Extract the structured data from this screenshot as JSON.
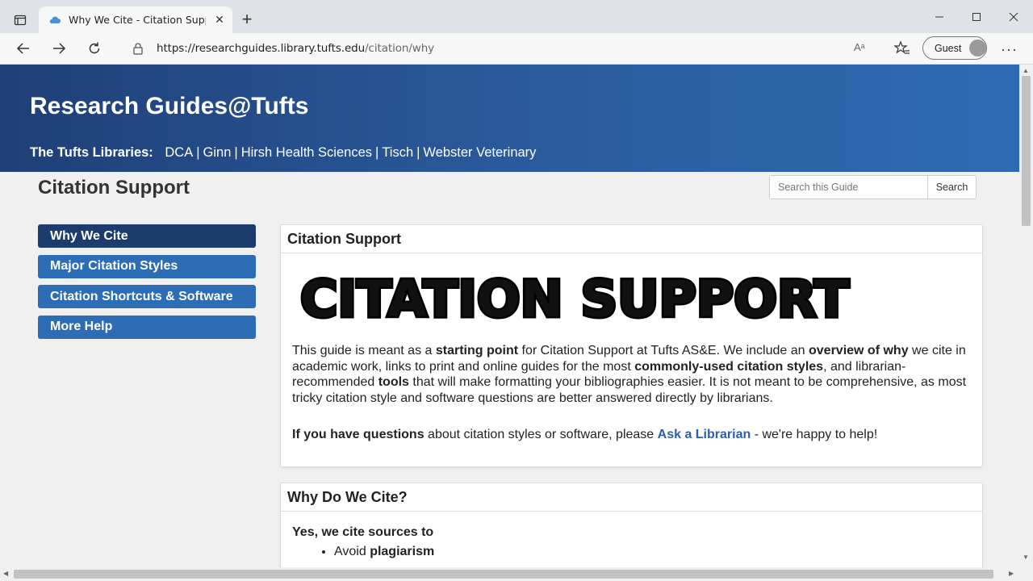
{
  "browser": {
    "tab_title": "Why We Cite - Citation Support - ",
    "url_domain": "https://researchguides.library.tufts.edu",
    "url_path": "/citation/why",
    "read_aloud": "Aᵃ",
    "profile_label": "Guest"
  },
  "banner": {
    "site_title": "Research Guides@Tufts",
    "libraries_label": "The Tufts Libraries:",
    "libraries": [
      "DCA",
      "Ginn",
      "Hirsh Health Sciences",
      "Tisch",
      "Webster Veterinary"
    ]
  },
  "guide": {
    "title": "Citation Support",
    "search_placeholder": "Search this Guide",
    "search_button": "Search"
  },
  "sidenav": {
    "items": [
      {
        "label": "Why We Cite",
        "active": true
      },
      {
        "label": "Major Citation Styles",
        "active": false
      },
      {
        "label": "Citation Shortcuts & Software",
        "active": false
      },
      {
        "label": "More Help",
        "active": false
      }
    ]
  },
  "box1": {
    "heading": "Citation Support",
    "image_text": "CITATION SUPPORT",
    "p1": {
      "t1": "This guide is meant as a ",
      "b1": "starting point",
      "t2": " for Citation Support at Tufts AS&E. We include an ",
      "b2": "overview of why",
      "t3": " we cite in academic work, links to print and online guides for the most ",
      "b3": "commonly-used citation styles",
      "t4": ", and librarian-recommended ",
      "b4": "tools",
      "t5": " that will make formatting your bibliographies easier. It is not meant to be comprehensive, as most tricky citation style and software questions are better answered directly by librarians."
    },
    "p2": {
      "b1": "If you have questions",
      "t1": " about citation styles or software, please ",
      "link": "Ask a Librarian",
      "t2": " - we're happy to help!"
    }
  },
  "box2": {
    "heading": "Why Do We Cite?",
    "lead": "Yes, we cite sources to",
    "bullet1_t": "Avoid ",
    "bullet1_b": "plagiarism"
  }
}
